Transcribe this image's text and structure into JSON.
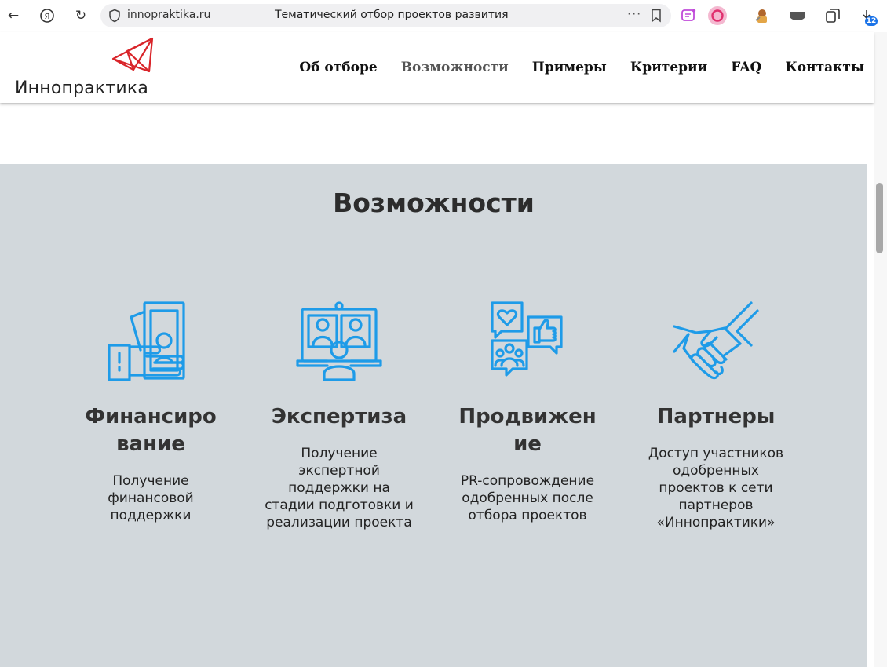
{
  "browser": {
    "url": "innopraktika.ru",
    "tab_title": "Тематический отбор проектов развития",
    "downloads_count": "12"
  },
  "site": {
    "logo_text": "Иннопрактика",
    "menu": [
      {
        "label": "Об отборе",
        "active": false
      },
      {
        "label": "Возможности",
        "active": true
      },
      {
        "label": "Примеры",
        "active": false
      },
      {
        "label": "Критерии",
        "active": false
      },
      {
        "label": "FAQ",
        "active": false
      },
      {
        "label": "Контакты",
        "active": false
      }
    ]
  },
  "section": {
    "title": "Возможности",
    "cards": [
      {
        "icon": "money-hand-icon",
        "title": "Финансиро вание",
        "desc": "Получение финансовой поддержки"
      },
      {
        "icon": "video-conference-icon",
        "title": "Экспертиза",
        "desc": "Получение экспертной поддержки на стадии подготовки и реализации проекта"
      },
      {
        "icon": "social-feedback-icon",
        "title": "Продвижен ие",
        "desc": "PR-сопровождение одобренных после отбора проектов"
      },
      {
        "icon": "handshake-icon",
        "title": "Партнеры",
        "desc": "Доступ участников одобренных проектов к сети партнеров «Иннопрактики»"
      }
    ]
  },
  "colors": {
    "accent_icon": "#1e9be8",
    "logo_red": "#d9252a",
    "section_bg": "#d2d8dc"
  }
}
